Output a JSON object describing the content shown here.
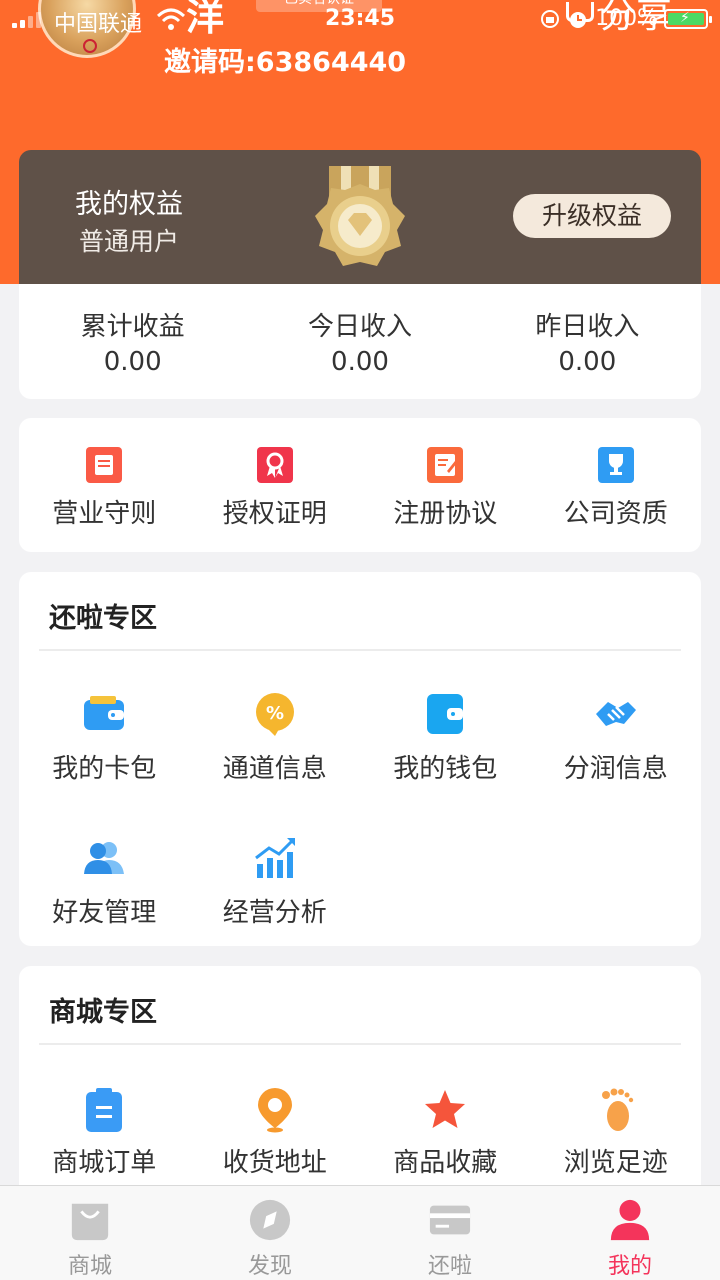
{
  "status_bar": {
    "carrier": "中国联通",
    "time": "23:45",
    "battery": "100%"
  },
  "profile": {
    "username_visible": "洋",
    "cert_tag": "已实名认证",
    "share_label": "分享",
    "invite_code": "邀请码:63864440"
  },
  "rights": {
    "title": "我的权益",
    "level": "普通用户",
    "upgrade_label": "升级权益"
  },
  "income": [
    {
      "label": "累计收益",
      "value": "0.00"
    },
    {
      "label": "今日收入",
      "value": "0.00"
    },
    {
      "label": "昨日收入",
      "value": "0.00"
    }
  ],
  "docs": [
    {
      "label": "营业守则",
      "icon": "rules-icon",
      "color": "#fa5a46"
    },
    {
      "label": "授权证明",
      "icon": "award-icon",
      "color": "#f0354b"
    },
    {
      "label": "注册协议",
      "icon": "agreement-icon",
      "color": "#fa6a3c"
    },
    {
      "label": "公司资质",
      "icon": "trophy-icon",
      "color": "#2f9cf3"
    }
  ],
  "repay_zone": {
    "title": "还啦专区",
    "items": [
      {
        "label": "我的卡包",
        "icon": "card-wallet-icon"
      },
      {
        "label": "通道信息",
        "icon": "percent-icon"
      },
      {
        "label": "我的钱包",
        "icon": "wallet-icon"
      },
      {
        "label": "分润信息",
        "icon": "handshake-icon"
      },
      {
        "label": "好友管理",
        "icon": "friends-icon"
      },
      {
        "label": "经营分析",
        "icon": "analytics-icon"
      }
    ]
  },
  "shop_zone": {
    "title": "商城专区",
    "items": [
      {
        "label": "商城订单",
        "icon": "order-icon"
      },
      {
        "label": "收货地址",
        "icon": "location-icon"
      },
      {
        "label": "商品收藏",
        "icon": "star-icon"
      },
      {
        "label": "浏览足迹",
        "icon": "footprint-icon"
      }
    ]
  },
  "tabbar": [
    {
      "label": "商城",
      "icon": "shopping-bag-icon",
      "active": false
    },
    {
      "label": "发现",
      "icon": "compass-icon",
      "active": false
    },
    {
      "label": "还啦",
      "icon": "card-icon",
      "active": false
    },
    {
      "label": "我的",
      "icon": "person-icon",
      "active": true
    }
  ],
  "colors": {
    "header": "#fe6a2c",
    "rights_bg": "#5f5148",
    "accent_blue": "#2f9cf3",
    "active_tab": "#f4345b"
  }
}
